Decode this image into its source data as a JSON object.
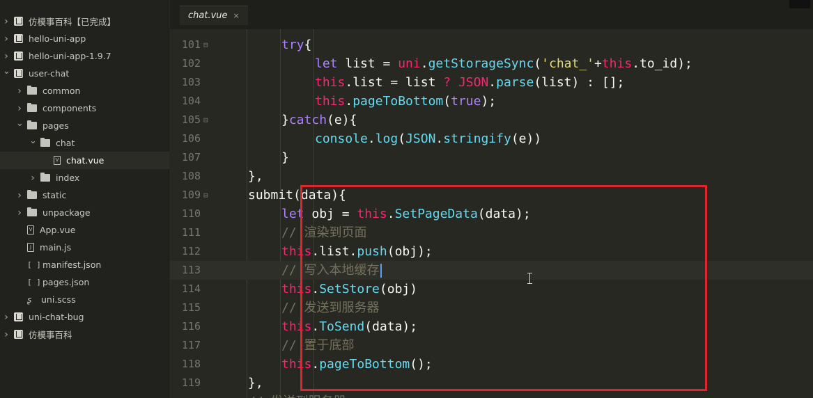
{
  "sidebar": {
    "items": [
      {
        "label": "仿模事百科【已完成】",
        "depth": 0,
        "icon": "project-icon",
        "chevron": "right"
      },
      {
        "label": "hello-uni-app",
        "depth": 0,
        "icon": "project-icon",
        "chevron": "right"
      },
      {
        "label": "hello-uni-app-1.9.7",
        "depth": 0,
        "icon": "project-icon",
        "chevron": "right"
      },
      {
        "label": "user-chat",
        "depth": 0,
        "icon": "project-icon",
        "chevron": "down"
      },
      {
        "label": "common",
        "depth": 1,
        "icon": "folder-icon",
        "chevron": "right"
      },
      {
        "label": "components",
        "depth": 1,
        "icon": "folder-icon",
        "chevron": "right"
      },
      {
        "label": "pages",
        "depth": 1,
        "icon": "folder-open-icon",
        "chevron": "down"
      },
      {
        "label": "chat",
        "depth": 2,
        "icon": "folder-open-icon",
        "chevron": "down"
      },
      {
        "label": "chat.vue",
        "depth": 3,
        "icon": "vue-file-icon",
        "chevron": "none",
        "selected": true
      },
      {
        "label": "index",
        "depth": 2,
        "icon": "folder-icon",
        "chevron": "right"
      },
      {
        "label": "static",
        "depth": 1,
        "icon": "folder-icon",
        "chevron": "right"
      },
      {
        "label": "unpackage",
        "depth": 1,
        "icon": "folder-icon",
        "chevron": "right"
      },
      {
        "label": "App.vue",
        "depth": 1,
        "icon": "vue-file-icon",
        "chevron": "none"
      },
      {
        "label": "main.js",
        "depth": 1,
        "icon": "js-file-icon",
        "chevron": "none"
      },
      {
        "label": "manifest.json",
        "depth": 1,
        "icon": "json-file-icon",
        "chevron": "none"
      },
      {
        "label": "pages.json",
        "depth": 1,
        "icon": "json-file-icon",
        "chevron": "none"
      },
      {
        "label": "uni.scss",
        "depth": 1,
        "icon": "scss-file-icon",
        "chevron": "none"
      },
      {
        "label": "uni-chat-bug",
        "depth": 0,
        "icon": "project-icon",
        "chevron": "right"
      },
      {
        "label": "仿模事百科",
        "depth": 0,
        "icon": "project-icon",
        "chevron": "right"
      }
    ]
  },
  "tabs": [
    {
      "label": "chat.vue",
      "active": true,
      "close": "×"
    }
  ],
  "editor": {
    "current_line": 113,
    "lines": [
      {
        "num": "101",
        "fold": "⊟",
        "indent": 2,
        "tokens": [
          [
            "kw",
            "try"
          ],
          [
            "plain",
            "{"
          ]
        ]
      },
      {
        "num": "102",
        "fold": "",
        "indent": 3,
        "tokens": [
          [
            "kw",
            "let"
          ],
          [
            "plain",
            " list = "
          ],
          [
            "this",
            "uni"
          ],
          [
            "plain",
            "."
          ],
          [
            "fn",
            "getStorageSync"
          ],
          [
            "plain",
            "("
          ],
          [
            "str",
            "'chat_'"
          ],
          [
            "plain",
            "+"
          ],
          [
            "this",
            "this"
          ],
          [
            "plain",
            ".to_id);"
          ]
        ]
      },
      {
        "num": "103",
        "fold": "",
        "indent": 3,
        "tokens": [
          [
            "this",
            "this"
          ],
          [
            "plain",
            ".list = list "
          ],
          [
            "this",
            "?"
          ],
          [
            "plain",
            " "
          ],
          [
            "this",
            "JSON"
          ],
          [
            "plain",
            "."
          ],
          [
            "fn",
            "parse"
          ],
          [
            "plain",
            "(list) : [];"
          ]
        ]
      },
      {
        "num": "104",
        "fold": "",
        "indent": 3,
        "tokens": [
          [
            "this",
            "this"
          ],
          [
            "plain",
            "."
          ],
          [
            "fn",
            "pageToBottom"
          ],
          [
            "plain",
            "("
          ],
          [
            "kw",
            "true"
          ],
          [
            "plain",
            ");"
          ]
        ]
      },
      {
        "num": "105",
        "fold": "⊟",
        "indent": 2,
        "tokens": [
          [
            "plain",
            "}"
          ],
          [
            "kw",
            "catch"
          ],
          [
            "plain",
            "(e){"
          ]
        ]
      },
      {
        "num": "106",
        "fold": "",
        "indent": 3,
        "tokens": [
          [
            "fn",
            "console"
          ],
          [
            "plain",
            "."
          ],
          [
            "fn",
            "log"
          ],
          [
            "plain",
            "("
          ],
          [
            "fn",
            "JSON"
          ],
          [
            "plain",
            "."
          ],
          [
            "fn",
            "stringify"
          ],
          [
            "plain",
            "(e))"
          ]
        ]
      },
      {
        "num": "107",
        "fold": "",
        "indent": 2,
        "tokens": [
          [
            "plain",
            "}"
          ]
        ]
      },
      {
        "num": "108",
        "fold": "",
        "indent": 1,
        "tokens": [
          [
            "plain",
            "},"
          ]
        ]
      },
      {
        "num": "109",
        "fold": "⊟",
        "indent": 1,
        "tokens": [
          [
            "plain",
            "submit(data){"
          ]
        ]
      },
      {
        "num": "110",
        "fold": "",
        "indent": 2,
        "tokens": [
          [
            "kw",
            "let"
          ],
          [
            "plain",
            " obj = "
          ],
          [
            "this",
            "this"
          ],
          [
            "plain",
            "."
          ],
          [
            "fn",
            "SetPageData"
          ],
          [
            "plain",
            "(data);"
          ]
        ]
      },
      {
        "num": "111",
        "fold": "",
        "indent": 2,
        "tokens": [
          [
            "cmt",
            "// 渲染到页面"
          ]
        ]
      },
      {
        "num": "112",
        "fold": "",
        "indent": 2,
        "tokens": [
          [
            "this",
            "this"
          ],
          [
            "plain",
            ".list."
          ],
          [
            "fn",
            "push"
          ],
          [
            "plain",
            "(obj);"
          ]
        ]
      },
      {
        "num": "113",
        "fold": "",
        "indent": 2,
        "tokens": [
          [
            "cmt",
            "// 写入本地缓存"
          ]
        ]
      },
      {
        "num": "114",
        "fold": "",
        "indent": 2,
        "tokens": [
          [
            "this",
            "this"
          ],
          [
            "plain",
            "."
          ],
          [
            "fn",
            "SetStore"
          ],
          [
            "plain",
            "(obj)"
          ]
        ]
      },
      {
        "num": "115",
        "fold": "",
        "indent": 2,
        "tokens": [
          [
            "cmt",
            "// 发送到服务器"
          ]
        ]
      },
      {
        "num": "116",
        "fold": "",
        "indent": 2,
        "tokens": [
          [
            "this",
            "this"
          ],
          [
            "plain",
            "."
          ],
          [
            "fn",
            "ToSend"
          ],
          [
            "plain",
            "(data);"
          ]
        ]
      },
      {
        "num": "117",
        "fold": "",
        "indent": 2,
        "tokens": [
          [
            "cmt",
            "// 置于底部"
          ]
        ]
      },
      {
        "num": "118",
        "fold": "",
        "indent": 2,
        "tokens": [
          [
            "this",
            "this"
          ],
          [
            "plain",
            "."
          ],
          [
            "fn",
            "pageToBottom"
          ],
          [
            "plain",
            "();"
          ]
        ]
      },
      {
        "num": "119",
        "fold": "",
        "indent": 1,
        "tokens": [
          [
            "plain",
            "},"
          ]
        ]
      },
      {
        "num": "",
        "fold": "",
        "indent": 1,
        "tokens": [
          [
            "cmt",
            "// 发送到服务器"
          ]
        ]
      }
    ]
  },
  "colors": {
    "background": "#272822",
    "sidebar": "#21221d",
    "highlight_box": "#e0252c",
    "keyword": "#ae81ff",
    "this": "#f92672",
    "function": "#66d9ef",
    "string": "#e6db74",
    "comment": "#75715e"
  }
}
